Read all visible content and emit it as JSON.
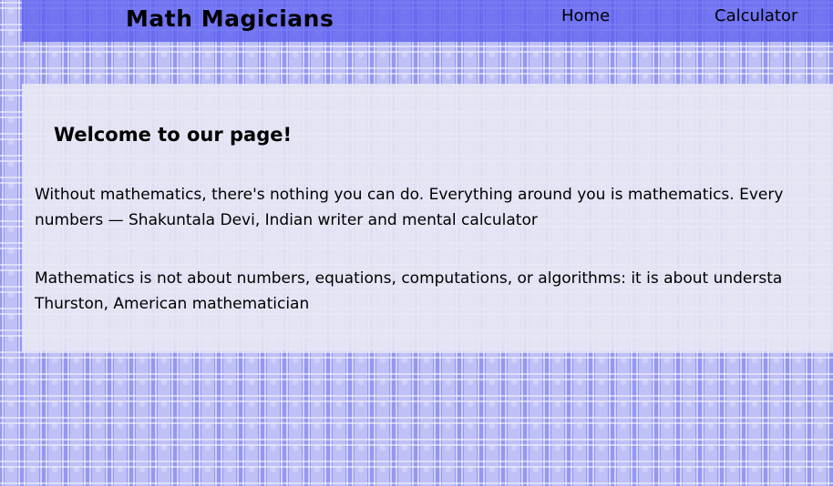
{
  "header": {
    "brand": "Math Magicians",
    "nav": {
      "home": "Home",
      "calculator": "Calculator"
    }
  },
  "main": {
    "title": "Welcome to our page!",
    "quotes": [
      {
        "line1": "Without mathematics, there's nothing you can do. Everything around you is mathematics. Every",
        "line2": "numbers — Shakuntala Devi, Indian writer and mental calculator"
      },
      {
        "line1": "Mathematics is not about numbers, equations, computations, or algorithms: it is about understa",
        "line2": "Thurston, American mathematician"
      }
    ]
  },
  "colors": {
    "header_bg": "#5c5ff0",
    "pattern_blue": "#8a8cf0",
    "content_bg": "#e8e8f4"
  }
}
